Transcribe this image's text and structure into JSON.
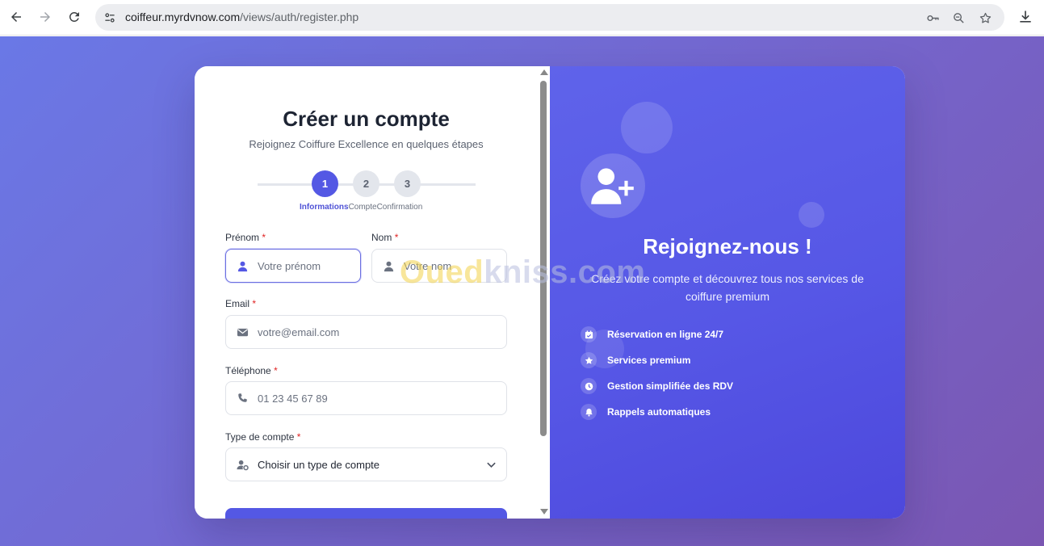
{
  "browser": {
    "url_host": "coiffeur.myrdvnow.com",
    "url_path": "/views/auth/register.php",
    "icons": [
      "back-icon",
      "forward-icon",
      "reload-icon",
      "site-settings-icon",
      "key-icon",
      "zoom-icon",
      "star-icon",
      "download-icon"
    ]
  },
  "form": {
    "title": "Créer un compte",
    "subtitle": "Rejoignez Coiffure Excellence en quelques étapes",
    "steps": [
      {
        "number": "1",
        "label": "Informations",
        "active": true
      },
      {
        "number": "2",
        "label": "Compte",
        "active": false
      },
      {
        "number": "3",
        "label": "Confirmation",
        "active": false
      }
    ],
    "required_mark": "*",
    "fields": {
      "prenom": {
        "label": "Prénom",
        "placeholder": "Votre prénom",
        "icon": "user-icon"
      },
      "nom": {
        "label": "Nom",
        "placeholder": "Votre nom",
        "icon": "user-icon"
      },
      "email": {
        "label": "Email",
        "placeholder": "votre@email.com",
        "icon": "envelope-icon"
      },
      "telephone": {
        "label": "Téléphone",
        "placeholder": "01 23 45 67 89",
        "icon": "phone-icon"
      },
      "type_compte": {
        "label": "Type de compte",
        "value": "Choisir un type de compte",
        "icon": "user-cog-icon"
      }
    }
  },
  "promo": {
    "title": "Rejoignez-nous !",
    "description": "Créez votre compte et découvrez tous nos services de coiffure premium",
    "features": [
      {
        "icon": "calendar-icon",
        "text": "Réservation en ligne 24/7"
      },
      {
        "icon": "star-icon",
        "text": "Services premium"
      },
      {
        "icon": "clock-icon",
        "text": "Gestion simplifiée des RDV"
      },
      {
        "icon": "bell-icon",
        "text": "Rappels automatiques"
      }
    ]
  },
  "watermark": {
    "part1": "Oued",
    "part2": "kniss",
    "part3": ".com"
  },
  "colors": {
    "accent": "#5458e4",
    "required": "#e02424",
    "promo_bg": "#5657e6"
  }
}
